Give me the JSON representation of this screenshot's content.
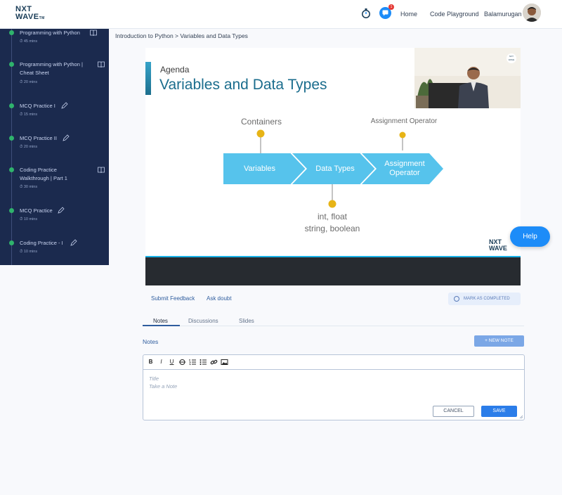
{
  "header": {
    "logo_line1": "NXT",
    "logo_line2": "WAVE",
    "logo_tm": "TM",
    "notification_count": "1",
    "nav": [
      "Home",
      "Code Playground"
    ],
    "user_name": "Balamurugan"
  },
  "sidebar": {
    "items": [
      {
        "title": "Programming with Python",
        "time": "45 mins",
        "icon": "book-icon"
      },
      {
        "title": "Programming with Python | Cheat Sheet",
        "time": "20 mins",
        "icon": "book-icon"
      },
      {
        "title": "MCQ Practice I",
        "time": "15 mins",
        "icon": "pencil-icon"
      },
      {
        "title": "MCQ Practice II",
        "time": "20 mins",
        "icon": "pencil-icon"
      },
      {
        "title": "Coding Practice Walkthrough | Part 1",
        "time": "30 mins",
        "icon": "book-icon"
      },
      {
        "title": "MCQ Practice",
        "time": "10 mins",
        "icon": "pencil-icon"
      },
      {
        "title": "Coding Practice - I",
        "time": "10 mins",
        "icon": "pencil-icon"
      }
    ]
  },
  "breadcrumb": "Introduction to Python > Variables and Data Types",
  "video": {
    "agenda": "Agenda",
    "title": "Variables and Data Types",
    "label_containers": "Containers",
    "label_assignment": "Assignment Operator",
    "chevrons": [
      "Variables",
      "Data Types",
      "Assignment Operator"
    ],
    "types_line1": "int, float",
    "types_line2": "string, boolean",
    "watermark_line1": "NXT",
    "watermark_line2": "WAVE",
    "cam_logo": "NXT WAVE"
  },
  "help_label": "Help",
  "actions": {
    "submit_feedback": "Submit Feedback",
    "ask_doubt": "Ask doubt",
    "mark_completed": "MARK AS COMPLETED"
  },
  "tabs": [
    "Notes",
    "Discussions",
    "Slides"
  ],
  "notes": {
    "label": "Notes",
    "new_note": "NEW NOTE",
    "title_placeholder": "Title",
    "body_placeholder": "Take a Note",
    "cancel": "CANCEL",
    "save": "SAVE"
  },
  "toolbar": {
    "bold": "B",
    "italic": "I",
    "underline": "U",
    "strike": "S"
  },
  "colors": {
    "sidebar_bg": "#1b2a4e",
    "accent": "#1d8cf8",
    "completed_dot": "#2fb36c",
    "slide_title": "#1b6d8d",
    "chevron": "#56c3ec",
    "marker": "#e7b416"
  }
}
